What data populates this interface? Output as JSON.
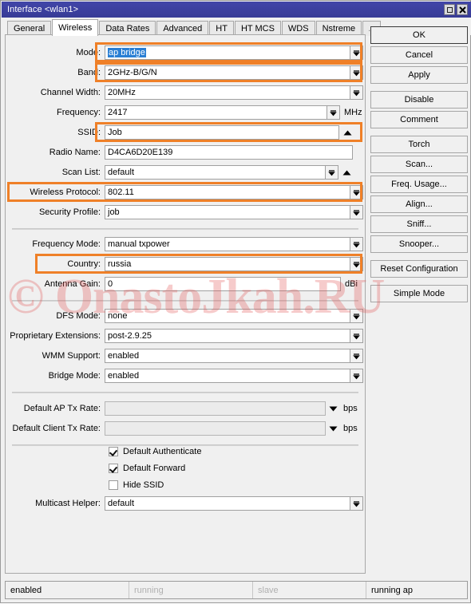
{
  "window": {
    "title": "Interface <wlan1>",
    "controls": [
      {
        "name": "maximize",
        "glyph": "□"
      },
      {
        "name": "close",
        "glyph": "✕"
      }
    ]
  },
  "tabs": [
    {
      "label": "General",
      "active": false
    },
    {
      "label": "Wireless",
      "active": true
    },
    {
      "label": "Data Rates",
      "active": false
    },
    {
      "label": "Advanced",
      "active": false
    },
    {
      "label": "HT",
      "active": false
    },
    {
      "label": "HT MCS",
      "active": false
    },
    {
      "label": "WDS",
      "active": false
    },
    {
      "label": "Nstreme",
      "active": false
    },
    {
      "label": "...",
      "active": false
    }
  ],
  "fields": {
    "mode": {
      "label": "Mode:",
      "value": "ap bridge"
    },
    "band": {
      "label": "Band:",
      "value": "2GHz-B/G/N"
    },
    "channel_width": {
      "label": "Channel Width:",
      "value": "20MHz"
    },
    "frequency": {
      "label": "Frequency:",
      "value": "2417",
      "unit": "MHz"
    },
    "ssid": {
      "label": "SSID:",
      "value": "Job"
    },
    "radio_name": {
      "label": "Radio Name:",
      "value": "D4CA6D20E139"
    },
    "scan_list": {
      "label": "Scan List:",
      "value": "default"
    },
    "wireless_protocol": {
      "label": "Wireless Protocol:",
      "value": "802.11"
    },
    "security_profile": {
      "label": "Security Profile:",
      "value": "job"
    },
    "frequency_mode": {
      "label": "Frequency Mode:",
      "value": "manual txpower"
    },
    "country": {
      "label": "Country:",
      "value": "russia"
    },
    "antenna_gain": {
      "label": "Antenna Gain:",
      "value": "0",
      "unit": "dBi"
    },
    "dfs_mode": {
      "label": "DFS Mode:",
      "value": "none"
    },
    "proprietary_extensions": {
      "label": "Proprietary Extensions:",
      "value": "post-2.9.25"
    },
    "wmm_support": {
      "label": "WMM Support:",
      "value": "enabled"
    },
    "bridge_mode": {
      "label": "Bridge Mode:",
      "value": "enabled"
    },
    "default_ap_tx_rate": {
      "label": "Default AP Tx Rate:",
      "value": "",
      "unit": "bps"
    },
    "default_client_tx_rate": {
      "label": "Default Client Tx Rate:",
      "value": "",
      "unit": "bps"
    },
    "multicast_helper": {
      "label": "Multicast Helper:",
      "value": "default"
    }
  },
  "checkboxes": [
    {
      "label": "Default Authenticate",
      "checked": true
    },
    {
      "label": "Default Forward",
      "checked": true
    },
    {
      "label": "Hide SSID",
      "checked": false
    }
  ],
  "buttons": [
    {
      "label": "OK",
      "primary": true,
      "gap": false
    },
    {
      "label": "Cancel",
      "primary": false,
      "gap": false
    },
    {
      "label": "Apply",
      "primary": false,
      "gap": false
    },
    {
      "label": "Disable",
      "primary": false,
      "gap": true
    },
    {
      "label": "Comment",
      "primary": false,
      "gap": false
    },
    {
      "label": "Torch",
      "primary": false,
      "gap": true
    },
    {
      "label": "Scan...",
      "primary": false,
      "gap": false
    },
    {
      "label": "Freq. Usage...",
      "primary": false,
      "gap": false
    },
    {
      "label": "Align...",
      "primary": false,
      "gap": false
    },
    {
      "label": "Sniff...",
      "primary": false,
      "gap": false
    },
    {
      "label": "Snooper...",
      "primary": false,
      "gap": false
    },
    {
      "label": "Reset Configuration",
      "primary": false,
      "gap": true
    },
    {
      "label": "Simple Mode",
      "primary": false,
      "gap": true
    }
  ],
  "status_bar": [
    {
      "text": "enabled",
      "dim": false
    },
    {
      "text": "running",
      "dim": true
    },
    {
      "text": "slave",
      "dim": true
    },
    {
      "text": "running ap",
      "dim": false
    }
  ],
  "watermark": {
    "text": "© OnastoJkah.RU",
    "color": "#e05252"
  },
  "highlight_color": "#ef8028",
  "highlighted_fields": [
    "mode",
    "band",
    "ssid",
    "wireless_protocol",
    "country"
  ]
}
